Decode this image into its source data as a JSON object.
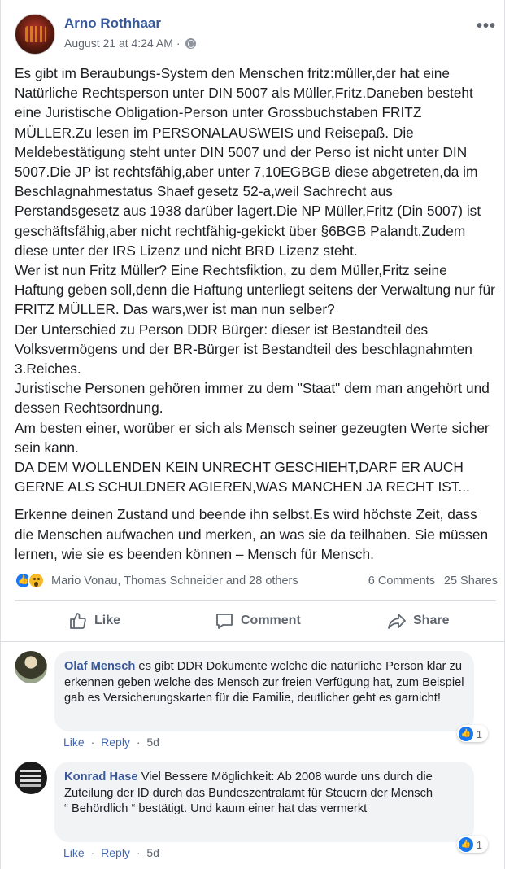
{
  "post": {
    "author": "Arno Rothhaar",
    "date": "August 21 at 4:24 AM",
    "dot": "·",
    "more": "•••",
    "body_p1": "Es gibt im Beraubungs-System den Menschen fritz:müller,der hat eine Natürliche Rechtsperson unter DIN 5007 als Müller,Fritz.Daneben besteht eine Juristische Obligation-Person unter Grossbuchstaben FRITZ MÜLLER.Zu lesen im PERSONALAUSWEIS und Reisepaß. Die Meldebestätigung steht unter DIN 5007 und der Perso ist nicht unter DIN 5007.Die JP ist rechtsfähig,aber unter 7,10EGBGB diese abgetreten,da im Beschlagnahmestatus Shaef gesetz 52-a,weil Sachrecht aus Perstandsgesetz aus 1938 darüber lagert.Die NP Müller,Fritz (Din 5007) ist geschäftsfähig,aber nicht rechtfähig-gekickt über §6BGB Palandt.Zudem diese unter der IRS Lizenz und nicht BRD Lizenz steht.\nWer ist nun Fritz Müller? Eine Rechtsfiktion, zu dem Müller,Fritz seine Haftung geben soll,denn die Haftung unterliegt seitens der Verwaltung nur für FRITZ MÜLLER. Das wars,wer ist man nun selber?\nDer Unterschied zu Person DDR Bürger: dieser ist Bestandteil des Volksvermögens und der BR-Bürger ist Bestandteil des beschlagnahmten 3.Reiches.\nJuristische Personen gehören immer zu dem \"Staat\" dem man angehört und dessen Rechtsordnung.\nAm besten einer, worüber er sich als Mensch seiner gezeugten Werte sicher sein kann.\nDA DEM WOLLENDEN KEIN UNRECHT GESCHIEHT,DARF ER AUCH GERNE ALS SCHULDNER AGIEREN,WAS MANCHEN JA RECHT IST...",
    "body_p2": "Erkenne deinen Zustand und beende ihn selbst.Es wird höchste Zeit, dass die Menschen aufwachen und merken, an was sie da teilhaben. Sie müssen lernen, wie sie es beenden können – Mensch für Mensch.",
    "reactions": {
      "names": "Mario Vonau, Thomas Schneider and 28 others",
      "comments": "6 Comments",
      "shares": "25 Shares",
      "like_glyph": "👍"
    },
    "actions": {
      "like": "Like",
      "comment": "Comment",
      "share": "Share"
    }
  },
  "comments": [
    {
      "author": "Olaf Mensch",
      "text": "es gibt DDR Dokumente welche die natürliche Person klar zu erkennen geben welche des Mensch zur freien Verfügung hat, zum Beispiel gab es Versicherungskarten für die Familie, deutlicher geht es garnicht!",
      "reaction_count": "1",
      "like": "Like",
      "reply": "Reply",
      "time": "5d",
      "sep": "·"
    },
    {
      "author": "Konrad Hase",
      "text": "Viel Bessere Möglichkeit: Ab 2008 wurde uns durch die Zuteilung der ID durch das Bundeszentralamt für Steuern der Mensch\n“ Behördlich “ bestätigt. Und kaum einer hat das vermerkt",
      "reaction_count": "1",
      "like": "Like",
      "reply": "Reply",
      "time": "5d",
      "sep": "·"
    }
  ],
  "colors": {
    "link": "#385898",
    "secondary": "#606770",
    "facebook_blue": "#1877f2",
    "bubble": "#f2f3f5"
  },
  "icons": [
    "more-icon",
    "globe-icon",
    "like-reaction-icon",
    "wow-reaction-icon",
    "thumbs-up-icon",
    "comment-icon",
    "share-arrow-icon"
  ]
}
